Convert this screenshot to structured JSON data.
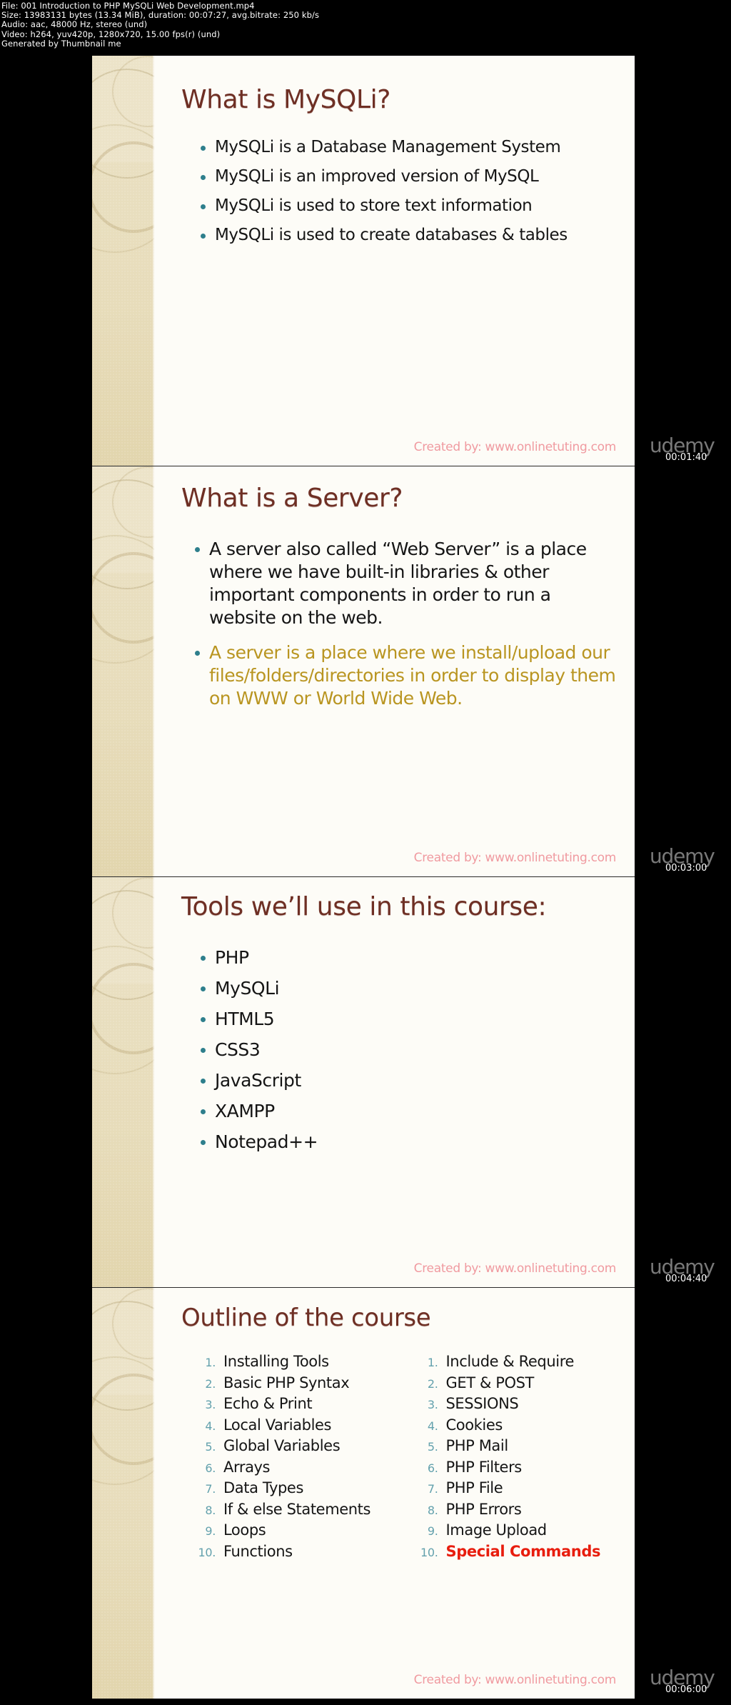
{
  "meta": {
    "line1": "File: 001 Introduction to PHP  MySQLi Web Development.mp4",
    "line2": "Size: 13983131 bytes (13.34 MiB), duration: 00:07:27, avg.bitrate: 250 kb/s",
    "line3": "Audio: aac, 48000 Hz, stereo (und)",
    "line4": "Video: h264, yuv420p, 1280x720, 15.00 fps(r) (und)",
    "line5": "Generated by Thumbnail me"
  },
  "footer_text": "Created by: www.onlinetuting.com",
  "colors": {
    "title": "#6e2f24",
    "bullet": "#2e7f8c",
    "gold_text": "#b99521",
    "red_text": "#e81d0e",
    "footer": "#f09aa0",
    "number": "#63a1ad",
    "band": "#e9dfc0"
  },
  "slides": [
    {
      "title": "What is MySQLi?",
      "bullets": [
        {
          "text": "MySQLi is a Database Management System",
          "style": "normal"
        },
        {
          "text": "MySQLi is an improved version of MySQL",
          "style": "normal"
        },
        {
          "text": "MySQLi is used to store text information",
          "style": "normal"
        },
        {
          "text": "MySQLi is used to create databases & tables",
          "style": "normal"
        }
      ],
      "watermark": {
        "logo": "udemy",
        "time": "00:01:40"
      }
    },
    {
      "title": "What is a Server?",
      "bullets": [
        {
          "text": "A server also called “Web Server” is a place where we have built-in libraries & other important components in order to run a website on the web.",
          "style": "normal"
        },
        {
          "text": "A server is a place where we install/upload our files/folders/directories in order to display them on WWW or World Wide Web.",
          "style": "gold"
        }
      ],
      "watermark": {
        "logo": "udemy",
        "time": "00:03:00"
      }
    },
    {
      "title": "Tools we’ll use in this course:",
      "bullets": [
        {
          "text": "PHP",
          "style": "normal"
        },
        {
          "text": "MySQLi",
          "style": "normal"
        },
        {
          "text": "HTML5",
          "style": "normal"
        },
        {
          "text": "CSS3",
          "style": "normal"
        },
        {
          "text": "JavaScript",
          "style": "normal"
        },
        {
          "text": "XAMPP",
          "style": "normal"
        },
        {
          "text": "Notepad++",
          "style": "normal"
        }
      ],
      "watermark": {
        "logo": "udemy",
        "time": "00:04:40"
      }
    },
    {
      "title": "Outline of the course",
      "columns": [
        {
          "items": [
            {
              "num": "1.",
              "text": "Installing Tools",
              "style": "normal"
            },
            {
              "num": "2.",
              "text": "Basic PHP Syntax",
              "style": "normal"
            },
            {
              "num": "3.",
              "text": "Echo & Print",
              "style": "normal"
            },
            {
              "num": "4.",
              "text": "Local Variables",
              "style": "normal"
            },
            {
              "num": "5.",
              "text": "Global Variables",
              "style": "normal"
            },
            {
              "num": "6.",
              "text": "Arrays",
              "style": "normal"
            },
            {
              "num": "7.",
              "text": "Data Types",
              "style": "normal"
            },
            {
              "num": "8.",
              "text": "If & else Statements",
              "style": "normal"
            },
            {
              "num": "9.",
              "text": "Loops",
              "style": "normal"
            },
            {
              "num": "10.",
              "text": "Functions",
              "style": "normal"
            }
          ]
        },
        {
          "items": [
            {
              "num": "1.",
              "text": "Include & Require",
              "style": "normal"
            },
            {
              "num": "2.",
              "text": "GET & POST",
              "style": "normal"
            },
            {
              "num": "3.",
              "text": "SESSIONS",
              "style": "normal"
            },
            {
              "num": "4.",
              "text": "Cookies",
              "style": "normal"
            },
            {
              "num": "5.",
              "text": "PHP Mail",
              "style": "normal"
            },
            {
              "num": "6.",
              "text": "PHP Filters",
              "style": "normal"
            },
            {
              "num": "7.",
              "text": "PHP File",
              "style": "normal"
            },
            {
              "num": "8.",
              "text": "PHP Errors",
              "style": "normal"
            },
            {
              "num": "9.",
              "text": "Image Upload",
              "style": "normal"
            },
            {
              "num": "10.",
              "text": "Special Commands",
              "style": "red"
            }
          ]
        }
      ],
      "watermark": {
        "logo": "udemy",
        "time": "00:06:00"
      }
    }
  ]
}
